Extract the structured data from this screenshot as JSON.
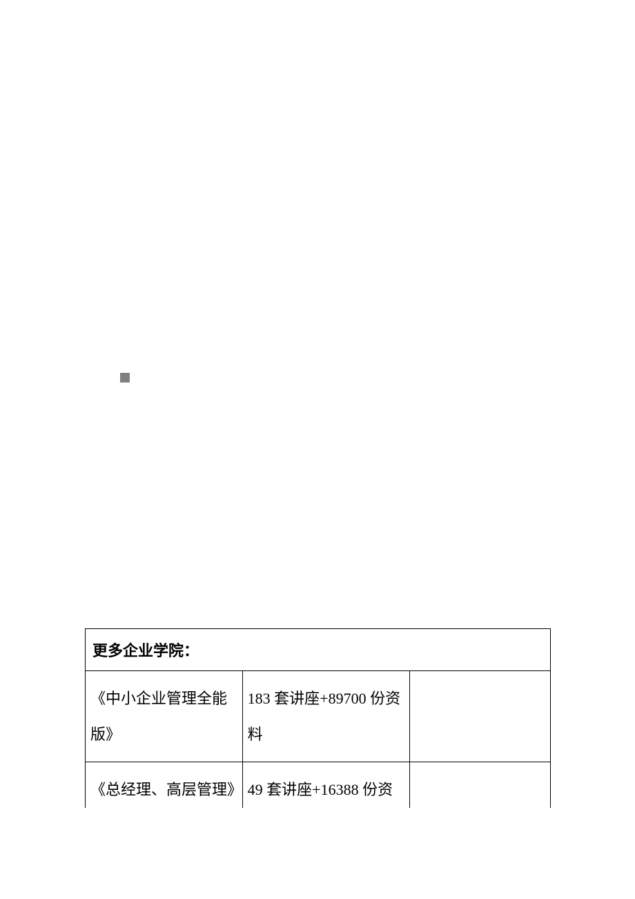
{
  "table": {
    "header": "更多企业学院：",
    "rows": [
      {
        "col1": "《中小企业管理全能版》",
        "col2": "183 套讲座+89700 份资料",
        "col3": ""
      },
      {
        "col1": "《总经理、高层管理》",
        "col2": "49 套讲座+16388 份资",
        "col3": ""
      }
    ]
  }
}
